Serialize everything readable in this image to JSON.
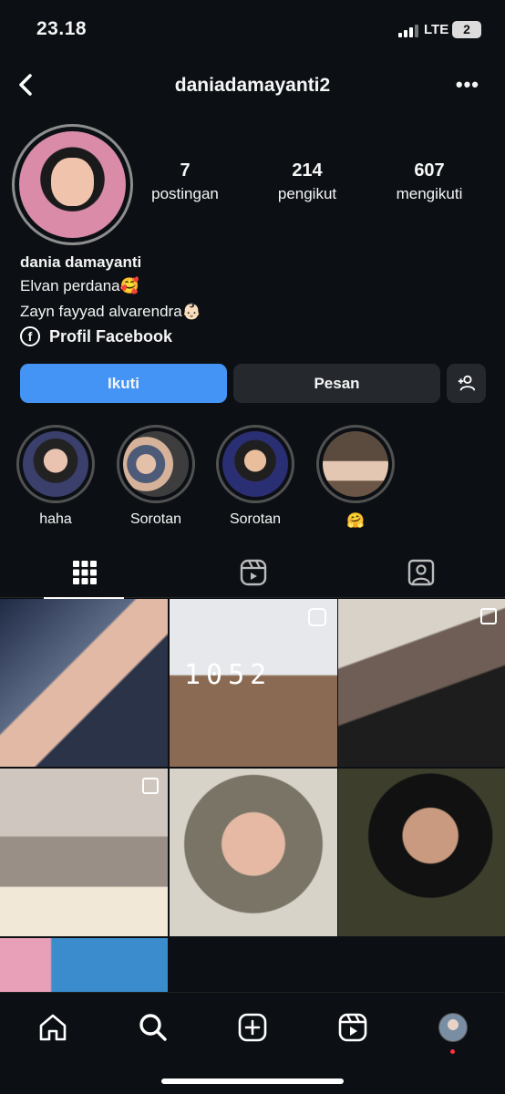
{
  "status": {
    "time": "23.18",
    "network": "LTE",
    "battery": "2"
  },
  "header": {
    "username": "daniadamayanti2",
    "back_icon": "chevron-left-icon",
    "more_icon": "more-horizontal-icon"
  },
  "profile": {
    "stats": [
      {
        "value": "7",
        "label": "postingan"
      },
      {
        "value": "214",
        "label": "pengikut"
      },
      {
        "value": "607",
        "label": "mengikuti"
      }
    ],
    "name": "dania damayanti",
    "bio": [
      "Elvan perdana🥰",
      "Zayn fayyad alvarendra👶🏻"
    ],
    "facebook_label": "Profil Facebook"
  },
  "buttons": {
    "follow": "Ikuti",
    "message": "Pesan",
    "add_icon": "person-add-icon"
  },
  "highlights": [
    {
      "label": "haha",
      "color": "#3a3f6b"
    },
    {
      "label": "Sorotan",
      "color": "#4d5a78"
    },
    {
      "label": "Sorotan",
      "color": "#2a2f73"
    },
    {
      "label": "🤗",
      "color": "#5b4a3e"
    }
  ],
  "tabs": [
    "grid-icon",
    "reels-icon",
    "tagged-icon"
  ],
  "posts": [
    {
      "type": "photo",
      "color": "#5d6a86"
    },
    {
      "type": "reel",
      "color": "#8a6a52",
      "overlay": "1052"
    },
    {
      "type": "multi",
      "color": "#6e5e55"
    },
    {
      "type": "multi",
      "color": "#9a8f86"
    },
    {
      "type": "photo",
      "color": "#7a7466"
    },
    {
      "type": "photo",
      "color": "#3d3f2c"
    },
    {
      "type": "photo",
      "color": "#3b8ccc"
    }
  ],
  "bottom_nav": [
    "home-icon",
    "search-icon",
    "create-icon",
    "reels-icon",
    "profile-avatar"
  ]
}
